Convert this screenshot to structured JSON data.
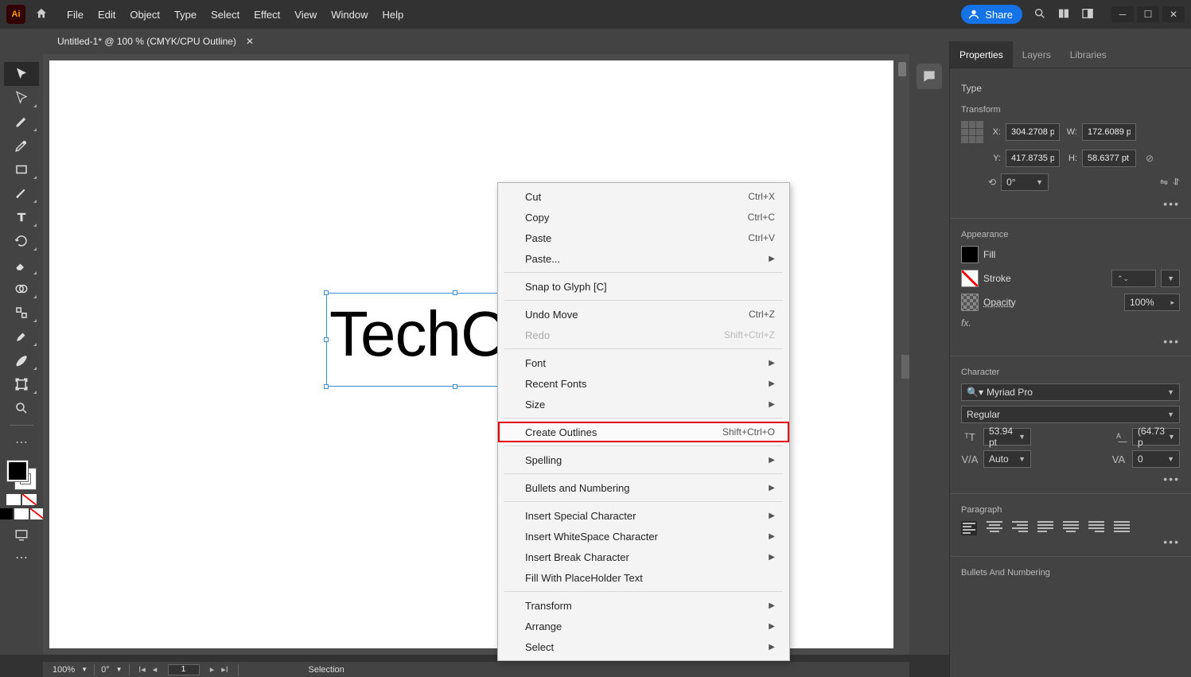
{
  "menubar": [
    "File",
    "Edit",
    "Object",
    "Type",
    "Select",
    "Effect",
    "View",
    "Window",
    "Help"
  ],
  "share_label": "Share",
  "doc_tab": "Untitled-1* @ 100 % (CMYK/CPU Outline)",
  "canvas_text": "TechC",
  "status": {
    "zoom": "100%",
    "rotate": "0°",
    "page": "1",
    "tool": "Selection"
  },
  "context_menu": [
    {
      "label": "Cut",
      "shortcut": "Ctrl+X"
    },
    {
      "label": "Copy",
      "shortcut": "Ctrl+C"
    },
    {
      "label": "Paste",
      "shortcut": "Ctrl+V"
    },
    {
      "label": "Paste...",
      "submenu": true
    },
    {
      "sep": true
    },
    {
      "label": "Snap to Glyph [C]"
    },
    {
      "sep": true
    },
    {
      "label": "Undo Move",
      "shortcut": "Ctrl+Z"
    },
    {
      "label": "Redo",
      "shortcut": "Shift+Ctrl+Z",
      "disabled": true
    },
    {
      "sep": true
    },
    {
      "label": "Font",
      "submenu": true
    },
    {
      "label": "Recent Fonts",
      "submenu": true
    },
    {
      "label": "Size",
      "submenu": true
    },
    {
      "sep": true
    },
    {
      "label": "Create Outlines",
      "shortcut": "Shift+Ctrl+O",
      "highlight": true
    },
    {
      "sep": true
    },
    {
      "label": "Spelling",
      "submenu": true
    },
    {
      "sep": true
    },
    {
      "label": "Bullets and Numbering",
      "submenu": true
    },
    {
      "sep": true
    },
    {
      "label": "Insert Special Character",
      "submenu": true
    },
    {
      "label": "Insert WhiteSpace Character",
      "submenu": true
    },
    {
      "label": "Insert Break Character",
      "submenu": true
    },
    {
      "label": "Fill With PlaceHolder Text"
    },
    {
      "sep": true
    },
    {
      "label": "Transform",
      "submenu": true
    },
    {
      "label": "Arrange",
      "submenu": true
    },
    {
      "label": "Select",
      "submenu": true
    }
  ],
  "panel": {
    "tabs": [
      "Properties",
      "Layers",
      "Libraries"
    ],
    "type_label": "Type",
    "transform": {
      "title": "Transform",
      "x": "304.2708 p",
      "y": "417.8735 p",
      "w": "172.6089 p",
      "h": "58.6377 pt",
      "rotate": "0°"
    },
    "appearance": {
      "title": "Appearance",
      "fill": "Fill",
      "stroke": "Stroke",
      "opacity": "Opacity",
      "opacity_val": "100%"
    },
    "character": {
      "title": "Character",
      "font": "Myriad Pro",
      "style": "Regular",
      "size": "53.94 pt",
      "leading": "(64.73 p",
      "kerning": "Auto",
      "tracking": "0"
    },
    "paragraph": {
      "title": "Paragraph"
    },
    "bullets": {
      "title": "Bullets And Numbering"
    }
  }
}
